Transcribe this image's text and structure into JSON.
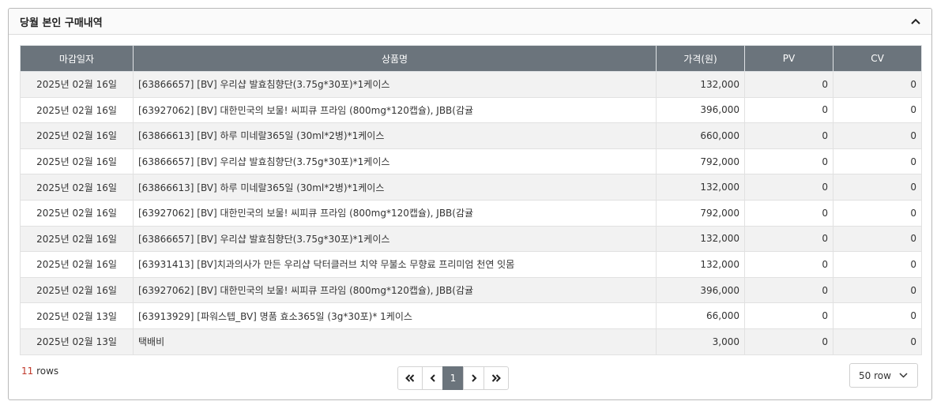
{
  "panel": {
    "title": "당월 본인 구매내역",
    "collapse_icon": "chevron-up-icon"
  },
  "table": {
    "headers": [
      "마감일자",
      "상품명",
      "가격(원)",
      "PV",
      "CV"
    ],
    "rows": [
      {
        "date": "2025년 02월 16일",
        "name": "[63866657] [BV] 우리샵 발효침향단(3.75g*30포)*1케이스",
        "price": "132,000",
        "pv": "0",
        "cv": "0"
      },
      {
        "date": "2025년 02월 16일",
        "name": "[63927062] [BV] 대한민국의 보물! 씨피큐 프라임 (800mg*120캡슐), JBB(감귤",
        "price": "396,000",
        "pv": "0",
        "cv": "0"
      },
      {
        "date": "2025년 02월 16일",
        "name": "[63866613] [BV] 하루 미네랄365일 (30ml*2병)*1케이스",
        "price": "660,000",
        "pv": "0",
        "cv": "0"
      },
      {
        "date": "2025년 02월 16일",
        "name": "[63866657] [BV] 우리샵 발효침향단(3.75g*30포)*1케이스",
        "price": "792,000",
        "pv": "0",
        "cv": "0"
      },
      {
        "date": "2025년 02월 16일",
        "name": "[63866613] [BV] 하루 미네랄365일 (30ml*2병)*1케이스",
        "price": "132,000",
        "pv": "0",
        "cv": "0"
      },
      {
        "date": "2025년 02월 16일",
        "name": "[63927062] [BV] 대한민국의 보물! 씨피큐 프라임 (800mg*120캡슐), JBB(감귤",
        "price": "792,000",
        "pv": "0",
        "cv": "0"
      },
      {
        "date": "2025년 02월 16일",
        "name": "[63866657] [BV] 우리샵 발효침향단(3.75g*30포)*1케이스",
        "price": "132,000",
        "pv": "0",
        "cv": "0"
      },
      {
        "date": "2025년 02월 16일",
        "name": "[63931413] [BV]치과의사가 만든 우리샵 닥터클러브 치약 무불소 무향료 프리미엄 천연 잇몸",
        "price": "132,000",
        "pv": "0",
        "cv": "0"
      },
      {
        "date": "2025년 02월 16일",
        "name": "[63927062] [BV] 대한민국의 보물! 씨피큐 프라임 (800mg*120캡슐), JBB(감귤",
        "price": "396,000",
        "pv": "0",
        "cv": "0"
      },
      {
        "date": "2025년 02월 13일",
        "name": "[63913929] [파워스텝_BV] 명품 효소365일 (3g*30포)* 1케이스",
        "price": "66,000",
        "pv": "0",
        "cv": "0"
      },
      {
        "date": "2025년 02월 13일",
        "name": "택배비",
        "price": "3,000",
        "pv": "0",
        "cv": "0"
      }
    ]
  },
  "footer": {
    "count": "11",
    "count_suffix": " rows",
    "count_color": "#c0392b",
    "pagination": {
      "first": "«",
      "prev": "‹",
      "current_page": "1",
      "next": "›",
      "last": "»"
    },
    "rows_per_page": "50 row"
  },
  "colors": {
    "header_bg": "#6b747c",
    "row_alt_bg": "#f2f2f2"
  }
}
